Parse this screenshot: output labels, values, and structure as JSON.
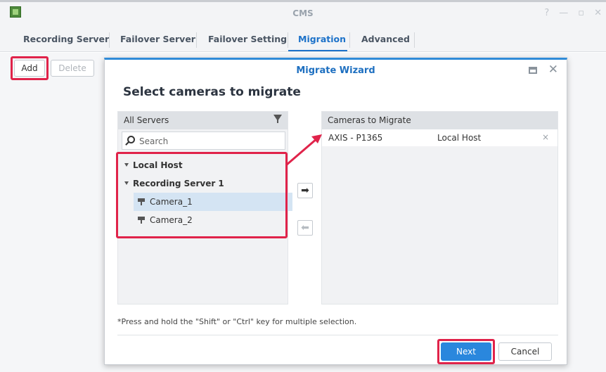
{
  "window": {
    "title": "CMS",
    "controls": [
      "?",
      "—",
      "▫",
      "✕"
    ]
  },
  "tabs": [
    {
      "label": "Recording Server"
    },
    {
      "label": "Failover Server"
    },
    {
      "label": "Failover Setting"
    },
    {
      "label": "Migration",
      "active": true
    },
    {
      "label": "Advanced"
    }
  ],
  "toolbar": {
    "add_label": "Add",
    "delete_label": "Delete"
  },
  "wizard": {
    "title": "Migrate Wizard",
    "heading": "Select cameras to migrate",
    "left_panel": {
      "header": "All Servers",
      "search_placeholder": "Search",
      "tree": {
        "local_host": "Local Host",
        "recording_server": "Recording Server 1",
        "cameras": [
          {
            "label": "Camera_1",
            "selected": true
          },
          {
            "label": "Camera_2",
            "selected": false
          }
        ]
      }
    },
    "right_panel": {
      "header": "Cameras to Migrate",
      "rows": [
        {
          "camera": "AXIS - P1365",
          "server": "Local Host",
          "remove": "×"
        }
      ]
    },
    "move_right_glyph": "➡",
    "move_left_glyph": "⬅",
    "hint": "*Press and hold the \"Shift\" or \"Ctrl\" key for multiple selection.",
    "next_label": "Next",
    "cancel_label": "Cancel",
    "close_glyph": "✕"
  },
  "colors": {
    "accent": "#2a87dd",
    "highlight": "#e0234a",
    "active_tab": "#1d72c9"
  }
}
